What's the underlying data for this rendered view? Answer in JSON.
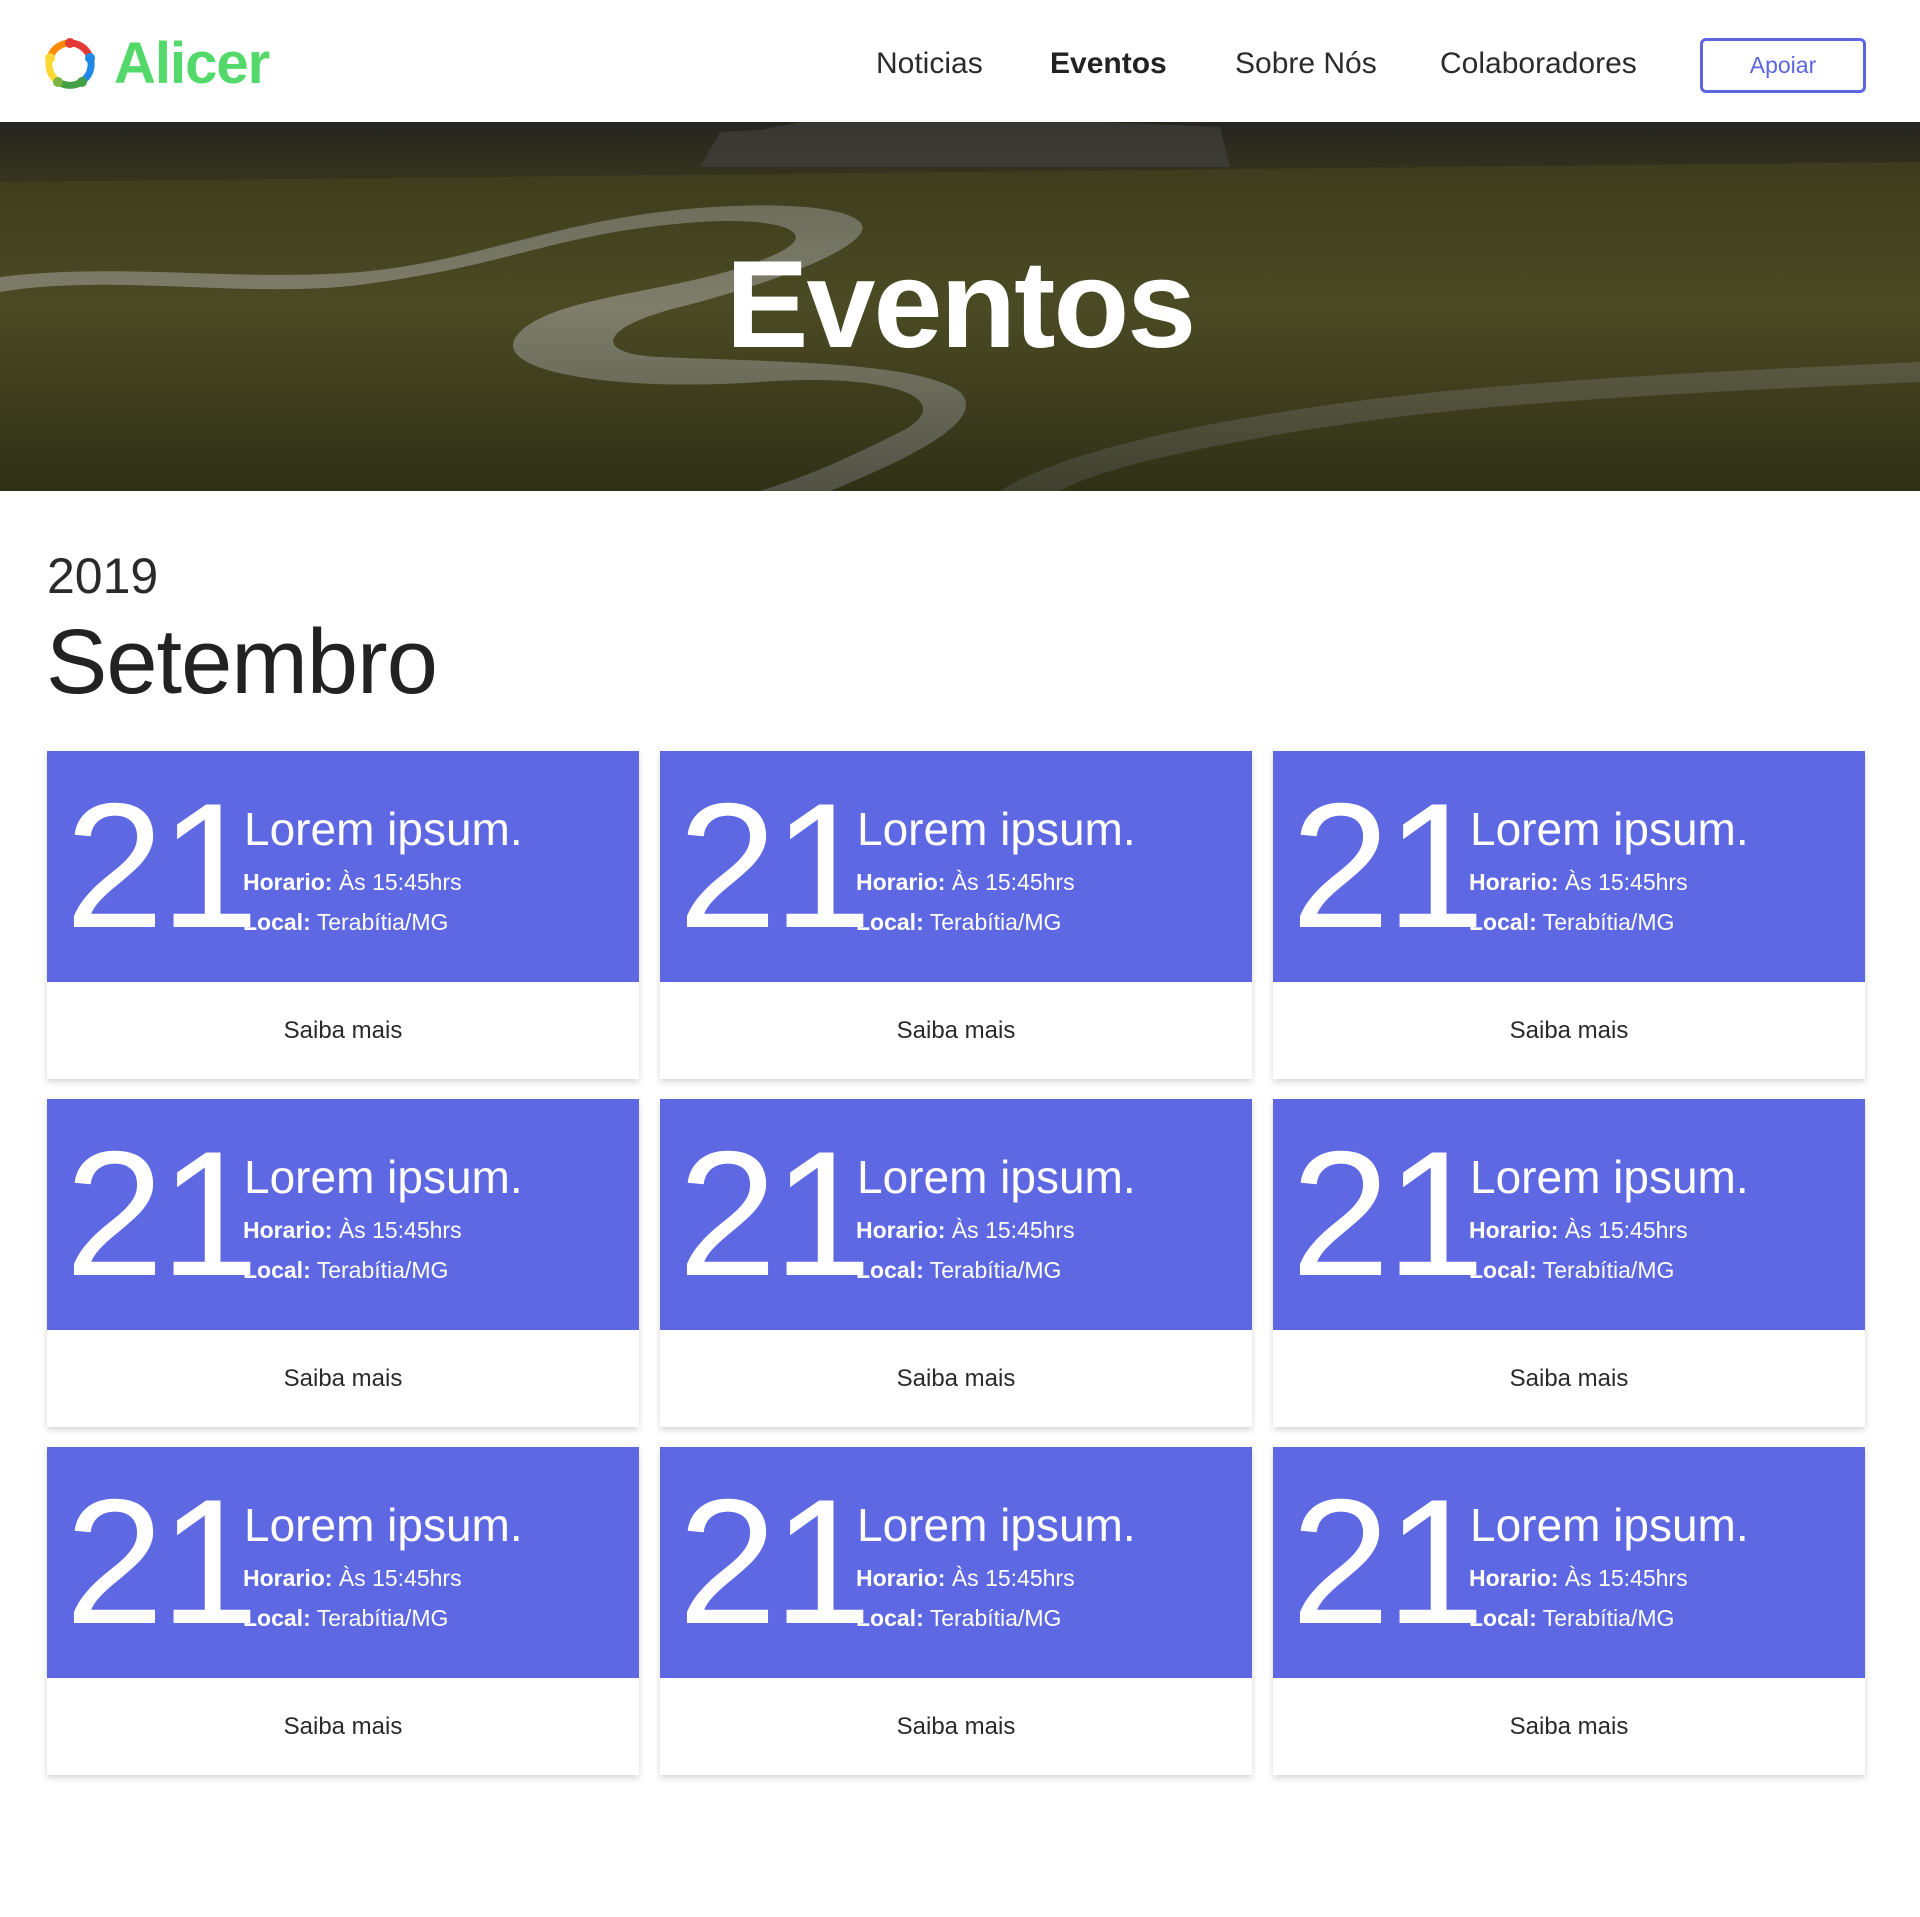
{
  "brand": {
    "name": "Alicer",
    "color": "#52d96a"
  },
  "nav": {
    "items": [
      {
        "label": "Noticias",
        "active": false
      },
      {
        "label": "Eventos",
        "active": true
      },
      {
        "label": "Sobre Nós",
        "active": false
      },
      {
        "label": "Colaboradores",
        "active": false
      }
    ],
    "cta_label": "Apoiar"
  },
  "hero": {
    "title": "Eventos"
  },
  "section": {
    "year": "2019",
    "month": "Setembro"
  },
  "colors": {
    "accent": "#5d68e2",
    "card_bg": "#ffffff"
  },
  "events": [
    {
      "day": "21",
      "title": "Lorem ipsum.",
      "time_label": "Horario:",
      "time": "Às 15:45hrs",
      "place_label": "Local:",
      "place": "Terabítia/MG",
      "more": "Saiba mais"
    },
    {
      "day": "21",
      "title": "Lorem ipsum.",
      "time_label": "Horario:",
      "time": "Às 15:45hrs",
      "place_label": "Local:",
      "place": "Terabítia/MG",
      "more": "Saiba mais"
    },
    {
      "day": "21",
      "title": "Lorem ipsum.",
      "time_label": "Horario:",
      "time": "Às 15:45hrs",
      "place_label": "Local:",
      "place": "Terabítia/MG",
      "more": "Saiba mais"
    },
    {
      "day": "21",
      "title": "Lorem ipsum.",
      "time_label": "Horario:",
      "time": "Às 15:45hrs",
      "place_label": "Local:",
      "place": "Terabítia/MG",
      "more": "Saiba mais"
    },
    {
      "day": "21",
      "title": "Lorem ipsum.",
      "time_label": "Horario:",
      "time": "Às 15:45hrs",
      "place_label": "Local:",
      "place": "Terabítia/MG",
      "more": "Saiba mais"
    },
    {
      "day": "21",
      "title": "Lorem ipsum.",
      "time_label": "Horario:",
      "time": "Às 15:45hrs",
      "place_label": "Local:",
      "place": "Terabítia/MG",
      "more": "Saiba mais"
    },
    {
      "day": "21",
      "title": "Lorem ipsum.",
      "time_label": "Horario:",
      "time": "Às 15:45hrs",
      "place_label": "Local:",
      "place": "Terabítia/MG",
      "more": "Saiba mais"
    },
    {
      "day": "21",
      "title": "Lorem ipsum.",
      "time_label": "Horario:",
      "time": "Às 15:45hrs",
      "place_label": "Local:",
      "place": "Terabítia/MG",
      "more": "Saiba mais"
    },
    {
      "day": "21",
      "title": "Lorem ipsum.",
      "time_label": "Horario:",
      "time": "Às 15:45hrs",
      "place_label": "Local:",
      "place": "Terabítia/MG",
      "more": "Saiba mais"
    }
  ]
}
